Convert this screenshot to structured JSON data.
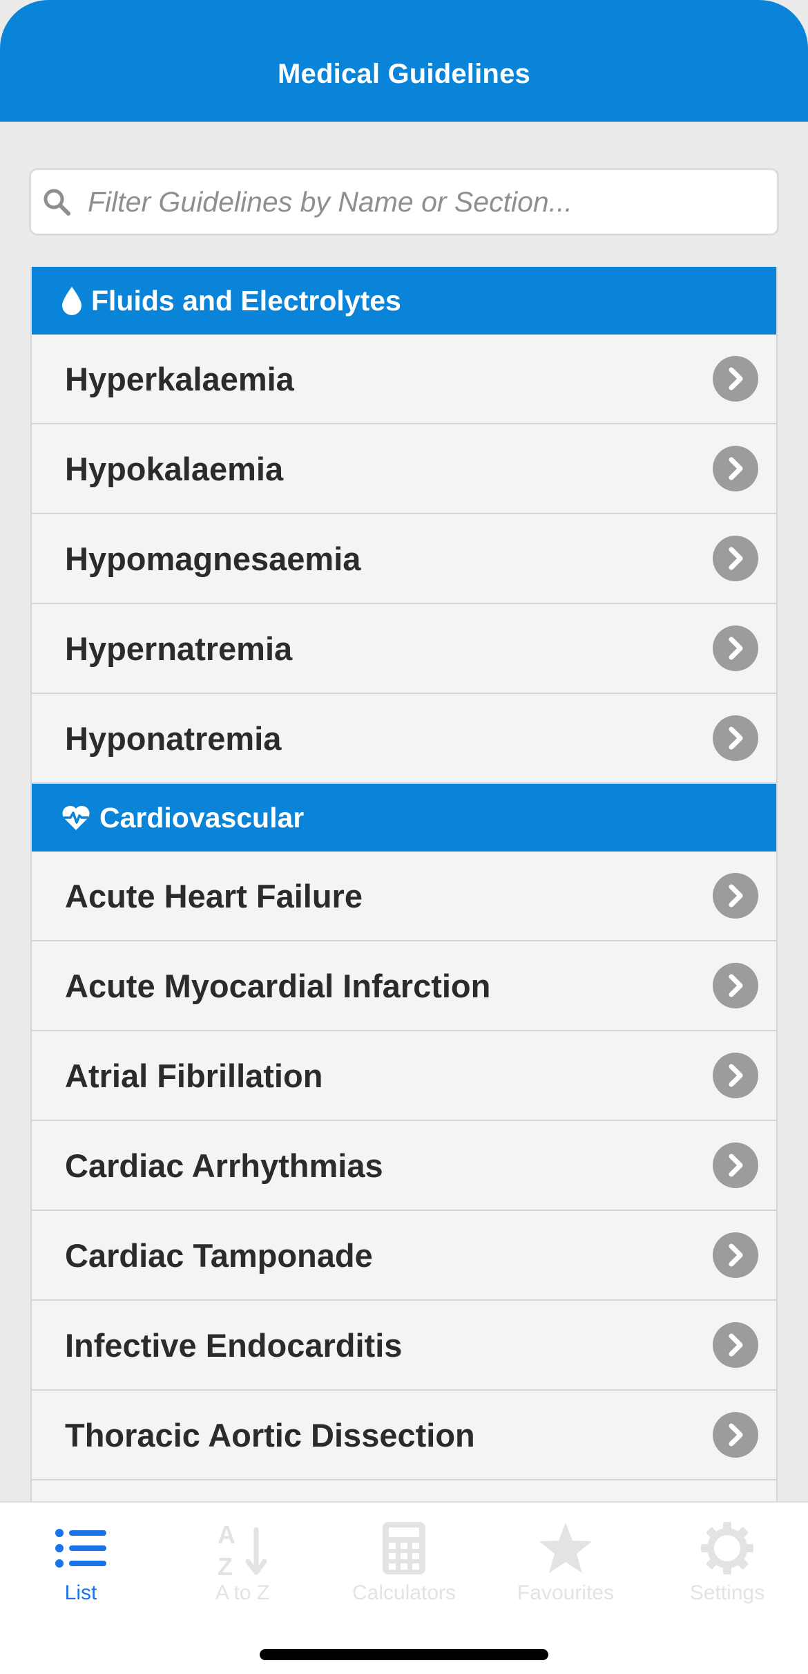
{
  "header": {
    "title": "Medical Guidelines"
  },
  "search": {
    "placeholder": "Filter Guidelines by Name or Section..."
  },
  "sections": [
    {
      "title": "Fluids and Electrolytes",
      "icon": "droplet-icon",
      "items": [
        "Hyperkalaemia",
        "Hypokalaemia",
        "Hypomagnesaemia",
        "Hypernatremia",
        "Hyponatremia"
      ]
    },
    {
      "title": "Cardiovascular",
      "icon": "heartbeat-icon",
      "items": [
        "Acute Heart Failure",
        "Acute Myocardial Infarction",
        "Atrial Fibrillation",
        "Cardiac Arrhythmias",
        "Cardiac Tamponade",
        "Infective Endocarditis",
        "Thoracic Aortic Dissection"
      ]
    }
  ],
  "tabs": [
    {
      "label": "List",
      "icon": "list-icon",
      "active": true
    },
    {
      "label": "A to Z",
      "icon": "sort-alpha-icon",
      "active": false
    },
    {
      "label": "Calculators",
      "icon": "calculator-icon",
      "active": false
    },
    {
      "label": "Favourites",
      "icon": "star-icon",
      "active": false
    },
    {
      "label": "Settings",
      "icon": "gear-icon",
      "active": false
    }
  ],
  "colors": {
    "accent": "#0984d8",
    "active_tab": "#1a73e8",
    "inactive_tab": "#e3e3e3",
    "chevron": "#9c9c9c"
  }
}
